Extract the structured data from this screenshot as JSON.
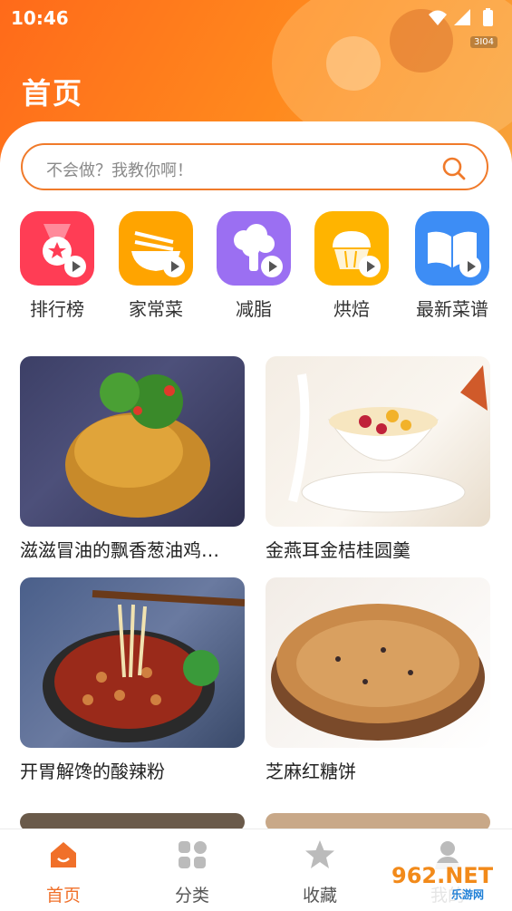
{
  "status": {
    "time": "10:46",
    "speed_badge": "3I04"
  },
  "page": {
    "title": "首页"
  },
  "search": {
    "placeholder": "不会做？我教你啊！"
  },
  "categories": [
    {
      "label": "排行榜",
      "icon": "medal-icon",
      "color": "#ff3d55"
    },
    {
      "label": "家常菜",
      "icon": "noodle-bowl-icon",
      "color": "#ffa400"
    },
    {
      "label": "减脂",
      "icon": "broccoli-icon",
      "color": "#9b6ff2"
    },
    {
      "label": "烘焙",
      "icon": "cupcake-icon",
      "color": "#ffb400"
    },
    {
      "label": "最新菜谱",
      "icon": "recipe-book-icon",
      "color": "#3d8df5"
    }
  ],
  "recipes": [
    {
      "title": "滋滋冒油的飘香葱油鸡…"
    },
    {
      "title": "金燕耳金桔桂圆羹"
    },
    {
      "title": "开胃解馋的酸辣粉"
    },
    {
      "title": "芝麻红糖饼"
    }
  ],
  "tabs": [
    {
      "label": "首页",
      "icon": "home-icon"
    },
    {
      "label": "分类",
      "icon": "grid-icon"
    },
    {
      "label": "收藏",
      "icon": "star-icon"
    },
    {
      "label": "我的",
      "icon": "user-icon"
    }
  ],
  "watermark": {
    "text": "962.NET",
    "sub": "乐游网"
  },
  "colors": {
    "accent": "#f0702a",
    "header": "#ff7a1e"
  }
}
